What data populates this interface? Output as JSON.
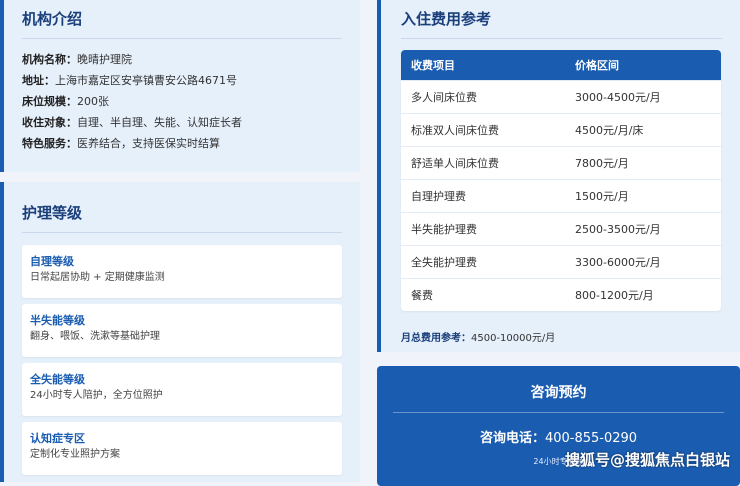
{
  "info": {
    "title": "机构介绍",
    "rows": [
      {
        "key": "机构名称：",
        "value": "晚晴护理院"
      },
      {
        "key": "地址：",
        "value": "上海市嘉定区安亭镇曹安公路4671号"
      },
      {
        "key": "床位规模：",
        "value": "200张"
      },
      {
        "key": "收住对象：",
        "value": "自理、半自理、失能、认知症长者"
      },
      {
        "key": "特色服务：",
        "value": "医养结合，支持医保实时结算"
      }
    ]
  },
  "care": {
    "title": "护理等级",
    "levels": [
      {
        "name": "自理等级",
        "desc": "日常起居协助 + 定期健康监测"
      },
      {
        "name": "半失能等级",
        "desc": "翻身、喂饭、洗漱等基础护理"
      },
      {
        "name": "全失能等级",
        "desc": "24小时专人陪护，全方位照护"
      },
      {
        "name": "认知症专区",
        "desc": "定制化专业照护方案"
      }
    ]
  },
  "fees": {
    "title": "入住费用参考",
    "headers": [
      "收费项目",
      "价格区间"
    ],
    "rows": [
      [
        "多人间床位费",
        "3000-4500元/月"
      ],
      [
        "标准双人间床位费",
        "4500元/月/床"
      ],
      [
        "舒适单人间床位费",
        "7800元/月"
      ],
      [
        "自理护理费",
        "1500元/月"
      ],
      [
        "半失能护理费",
        "2500-3500元/月"
      ],
      [
        "全失能护理费",
        "3300-6000元/月"
      ],
      [
        "餐费",
        "800-1200元/月"
      ]
    ],
    "total_label": "月总费用参考：",
    "total_value": "4500-10000元/月"
  },
  "contact": {
    "title": "咨询预约",
    "phone_label": "咨询电话：",
    "phone": "400-855-0290",
    "note": "24小时专业顾"
  },
  "watermark": "搜狐号@搜狐焦点白银站"
}
